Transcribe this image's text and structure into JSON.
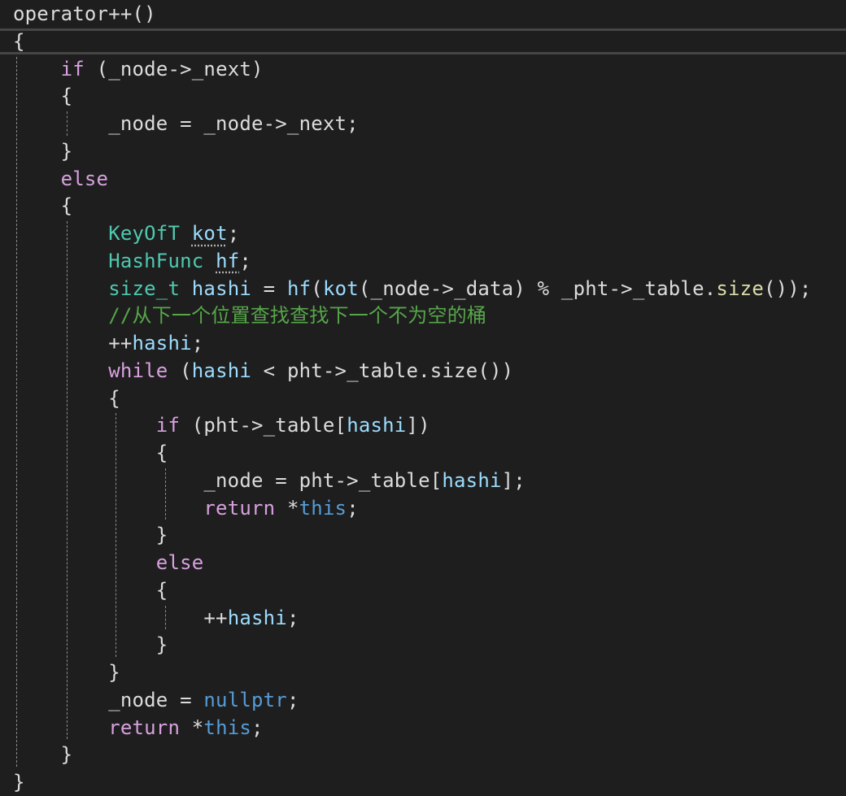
{
  "editor": {
    "language": "cpp",
    "colors": {
      "background": "#1e1e1e",
      "text": "#dcdcdc",
      "control_keyword": "#d8a0df",
      "keyword": "#569cd6",
      "type": "#4ec9b0",
      "variable": "#9cdcfe",
      "function": "#dcdcaa",
      "comment": "#57a64a"
    },
    "lines": [
      [
        {
          "t": "operator++()",
          "c": "plain"
        }
      ],
      [
        {
          "t": "{",
          "c": "plain"
        }
      ],
      [
        {
          "t": "    "
        },
        {
          "t": "if",
          "c": "kw"
        },
        {
          "t": " (_node->_next)",
          "c": "plain"
        }
      ],
      [
        {
          "t": "    {",
          "c": "plain"
        }
      ],
      [
        {
          "t": "        _node = _node->_next;",
          "c": "plain"
        }
      ],
      [
        {
          "t": "    }",
          "c": "plain"
        }
      ],
      [
        {
          "t": "    "
        },
        {
          "t": "else",
          "c": "kw"
        }
      ],
      [
        {
          "t": "    {",
          "c": "plain"
        }
      ],
      [
        {
          "t": "        "
        },
        {
          "t": "KeyOfT",
          "c": "type"
        },
        {
          "t": " "
        },
        {
          "t": "kot",
          "c": "var squig"
        },
        {
          "t": ";",
          "c": "plain"
        }
      ],
      [
        {
          "t": "        "
        },
        {
          "t": "HashFunc",
          "c": "type"
        },
        {
          "t": " "
        },
        {
          "t": "hf",
          "c": "var squig"
        },
        {
          "t": ";",
          "c": "plain"
        }
      ],
      [
        {
          "t": "        "
        },
        {
          "t": "size_t",
          "c": "type"
        },
        {
          "t": " "
        },
        {
          "t": "hashi",
          "c": "var"
        },
        {
          "t": " = ",
          "c": "plain"
        },
        {
          "t": "hf",
          "c": "var"
        },
        {
          "t": "(",
          "c": "plain"
        },
        {
          "t": "kot",
          "c": "var"
        },
        {
          "t": "(_node->_data) % _pht->_table.",
          "c": "plain"
        },
        {
          "t": "size",
          "c": "fn"
        },
        {
          "t": "());",
          "c": "plain"
        }
      ],
      [
        {
          "t": "        "
        },
        {
          "t": "//从下一个位置查找查找下一个不为空的桶",
          "c": "cm"
        }
      ],
      [
        {
          "t": "        ++",
          "c": "plain"
        },
        {
          "t": "hashi",
          "c": "var"
        },
        {
          "t": ";",
          "c": "plain"
        }
      ],
      [
        {
          "t": "        "
        },
        {
          "t": "while",
          "c": "kw"
        },
        {
          "t": " (",
          "c": "plain"
        },
        {
          "t": "hashi",
          "c": "var"
        },
        {
          "t": " < pht->_table.size())",
          "c": "plain"
        }
      ],
      [
        {
          "t": "        {",
          "c": "plain"
        }
      ],
      [
        {
          "t": "            "
        },
        {
          "t": "if",
          "c": "kw"
        },
        {
          "t": " (pht->_table[",
          "c": "plain"
        },
        {
          "t": "hashi",
          "c": "var"
        },
        {
          "t": "])",
          "c": "plain"
        }
      ],
      [
        {
          "t": "            {",
          "c": "plain"
        }
      ],
      [
        {
          "t": "                _node = pht->_table[",
          "c": "plain"
        },
        {
          "t": "hashi",
          "c": "var"
        },
        {
          "t": "];",
          "c": "plain"
        }
      ],
      [
        {
          "t": "                "
        },
        {
          "t": "return",
          "c": "kw"
        },
        {
          "t": " *",
          "c": "plain"
        },
        {
          "t": "this",
          "c": "kwb"
        },
        {
          "t": ";",
          "c": "plain"
        }
      ],
      [
        {
          "t": "            }",
          "c": "plain"
        }
      ],
      [
        {
          "t": "            "
        },
        {
          "t": "else",
          "c": "kw"
        }
      ],
      [
        {
          "t": "            {",
          "c": "plain"
        }
      ],
      [
        {
          "t": "                ++",
          "c": "plain"
        },
        {
          "t": "hashi",
          "c": "var"
        },
        {
          "t": ";",
          "c": "plain"
        }
      ],
      [
        {
          "t": "            }",
          "c": "plain"
        }
      ],
      [
        {
          "t": "        }",
          "c": "plain"
        }
      ],
      [
        {
          "t": "        _node = ",
          "c": "plain"
        },
        {
          "t": "nullptr",
          "c": "kwb"
        },
        {
          "t": ";",
          "c": "plain"
        }
      ],
      [
        {
          "t": "        "
        },
        {
          "t": "return",
          "c": "kw"
        },
        {
          "t": " *",
          "c": "plain"
        },
        {
          "t": "this",
          "c": "kwb"
        },
        {
          "t": ";",
          "c": "plain"
        }
      ],
      [
        {
          "t": "    }",
          "c": "plain"
        }
      ],
      [
        {
          "t": "}",
          "c": "plain"
        }
      ]
    ]
  }
}
